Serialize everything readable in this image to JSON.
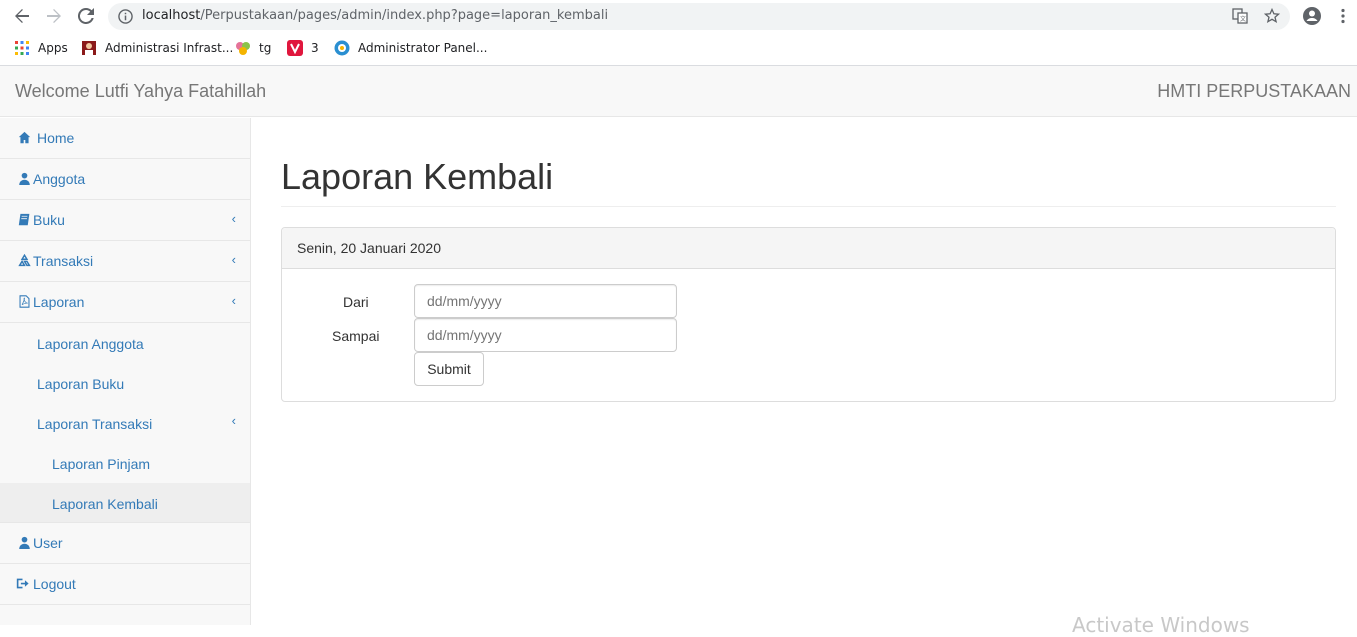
{
  "browser": {
    "url_host": "localhost",
    "url_path": "/Perpustakaan/pages/admin/index.php?page=laporan_kembali",
    "bookmarks": [
      {
        "label": "Apps",
        "icon": "apps-grid-icon"
      },
      {
        "label": "Administrasi Infrast...",
        "icon": "admin-avatar-icon"
      },
      {
        "label": "tg",
        "icon": "tg-flower-icon"
      },
      {
        "label": "3",
        "icon": "vivino-icon"
      },
      {
        "label": "Administrator Panel...",
        "icon": "admin-panel-icon"
      }
    ]
  },
  "navbar": {
    "welcome": "Welcome Lutfi Yahya Fatahillah",
    "brand": "HMTI PERPUSTAKAAN"
  },
  "sidebar": {
    "items": [
      {
        "label": "Home",
        "icon": "home-icon"
      },
      {
        "label": "Anggota",
        "icon": "user-icon"
      },
      {
        "label": "Buku",
        "icon": "book-icon"
      },
      {
        "label": "Transaksi",
        "icon": "recycle-icon"
      },
      {
        "label": "Laporan",
        "icon": "pdf-file-icon"
      },
      {
        "label": "Laporan Anggota"
      },
      {
        "label": "Laporan Buku"
      },
      {
        "label": "Laporan Transaksi"
      },
      {
        "label": "Laporan Pinjam"
      },
      {
        "label": "Laporan Kembali"
      },
      {
        "label": "User",
        "icon": "user-icon"
      },
      {
        "label": "Logout",
        "icon": "logout-icon"
      }
    ]
  },
  "main": {
    "title": "Laporan Kembali",
    "panel_heading": "Senin, 20 Januari 2020",
    "form": {
      "dari_label": "Dari",
      "dari_placeholder": "dd/mm/yyyy",
      "sampai_label": "Sampai",
      "sampai_placeholder": "dd/mm/yyyy",
      "submit_label": "Submit"
    }
  },
  "watermark": "Activate Windows",
  "colors": {
    "link": "#337ab7",
    "navbar_bg": "#f8f8f8",
    "panel_head_bg": "#f5f5f5"
  }
}
